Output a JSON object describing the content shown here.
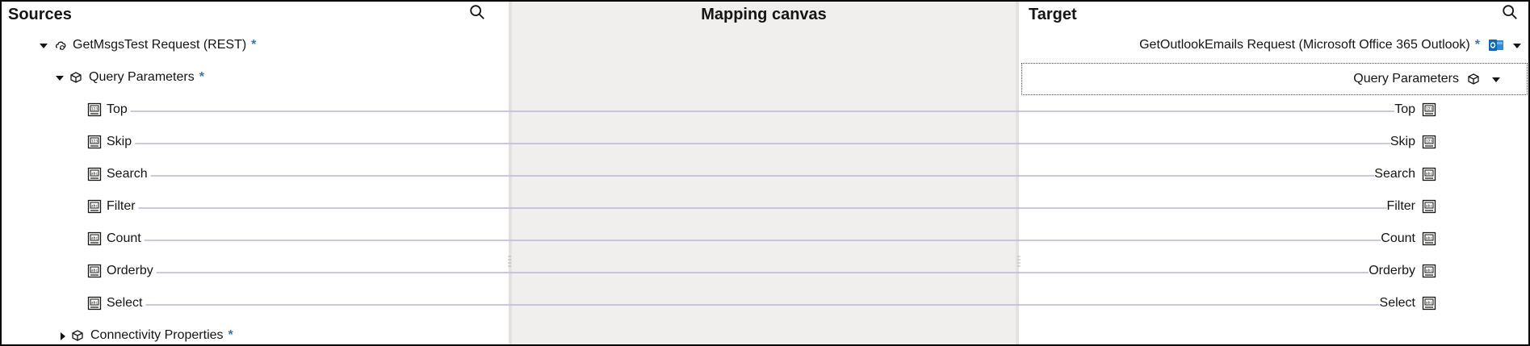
{
  "panels": {
    "sources_title": "Sources",
    "canvas_title": "Mapping canvas",
    "target_title": "Target"
  },
  "sources": {
    "root": {
      "label": "GetMsgsTest Request (REST)",
      "required": "*"
    },
    "group": {
      "label": "Query Parameters",
      "required": "*"
    },
    "fields": [
      {
        "label": "Top",
        "icon": "number-field-icon"
      },
      {
        "label": "Skip",
        "icon": "number-field-icon"
      },
      {
        "label": "Search",
        "icon": "string-field-icon"
      },
      {
        "label": "Filter",
        "icon": "string-field-icon"
      },
      {
        "label": "Count",
        "icon": "string-field-icon"
      },
      {
        "label": "Orderby",
        "icon": "string-field-icon"
      },
      {
        "label": "Select",
        "icon": "string-field-icon"
      }
    ],
    "collapsed_group": {
      "label": "Connectivity Properties",
      "required": "*"
    }
  },
  "target": {
    "root": {
      "label": "GetOutlookEmails Request (Microsoft Office 365 Outlook)",
      "required": "*"
    },
    "group": {
      "label": "Query Parameters"
    },
    "fields": [
      {
        "label": "Top",
        "icon": "number-field-icon"
      },
      {
        "label": "Skip",
        "icon": "number-field-icon"
      },
      {
        "label": "Search",
        "icon": "string-field-icon"
      },
      {
        "label": "Filter",
        "icon": "string-field-icon"
      },
      {
        "label": "Count",
        "icon": "string-field-icon"
      },
      {
        "label": "Orderby",
        "icon": "string-field-icon"
      },
      {
        "label": "Select",
        "icon": "string-field-icon"
      }
    ]
  },
  "colors": {
    "required": "#227bc5",
    "mapping_line": "#b7b9d8",
    "canvas_bg": "#f1efed"
  }
}
